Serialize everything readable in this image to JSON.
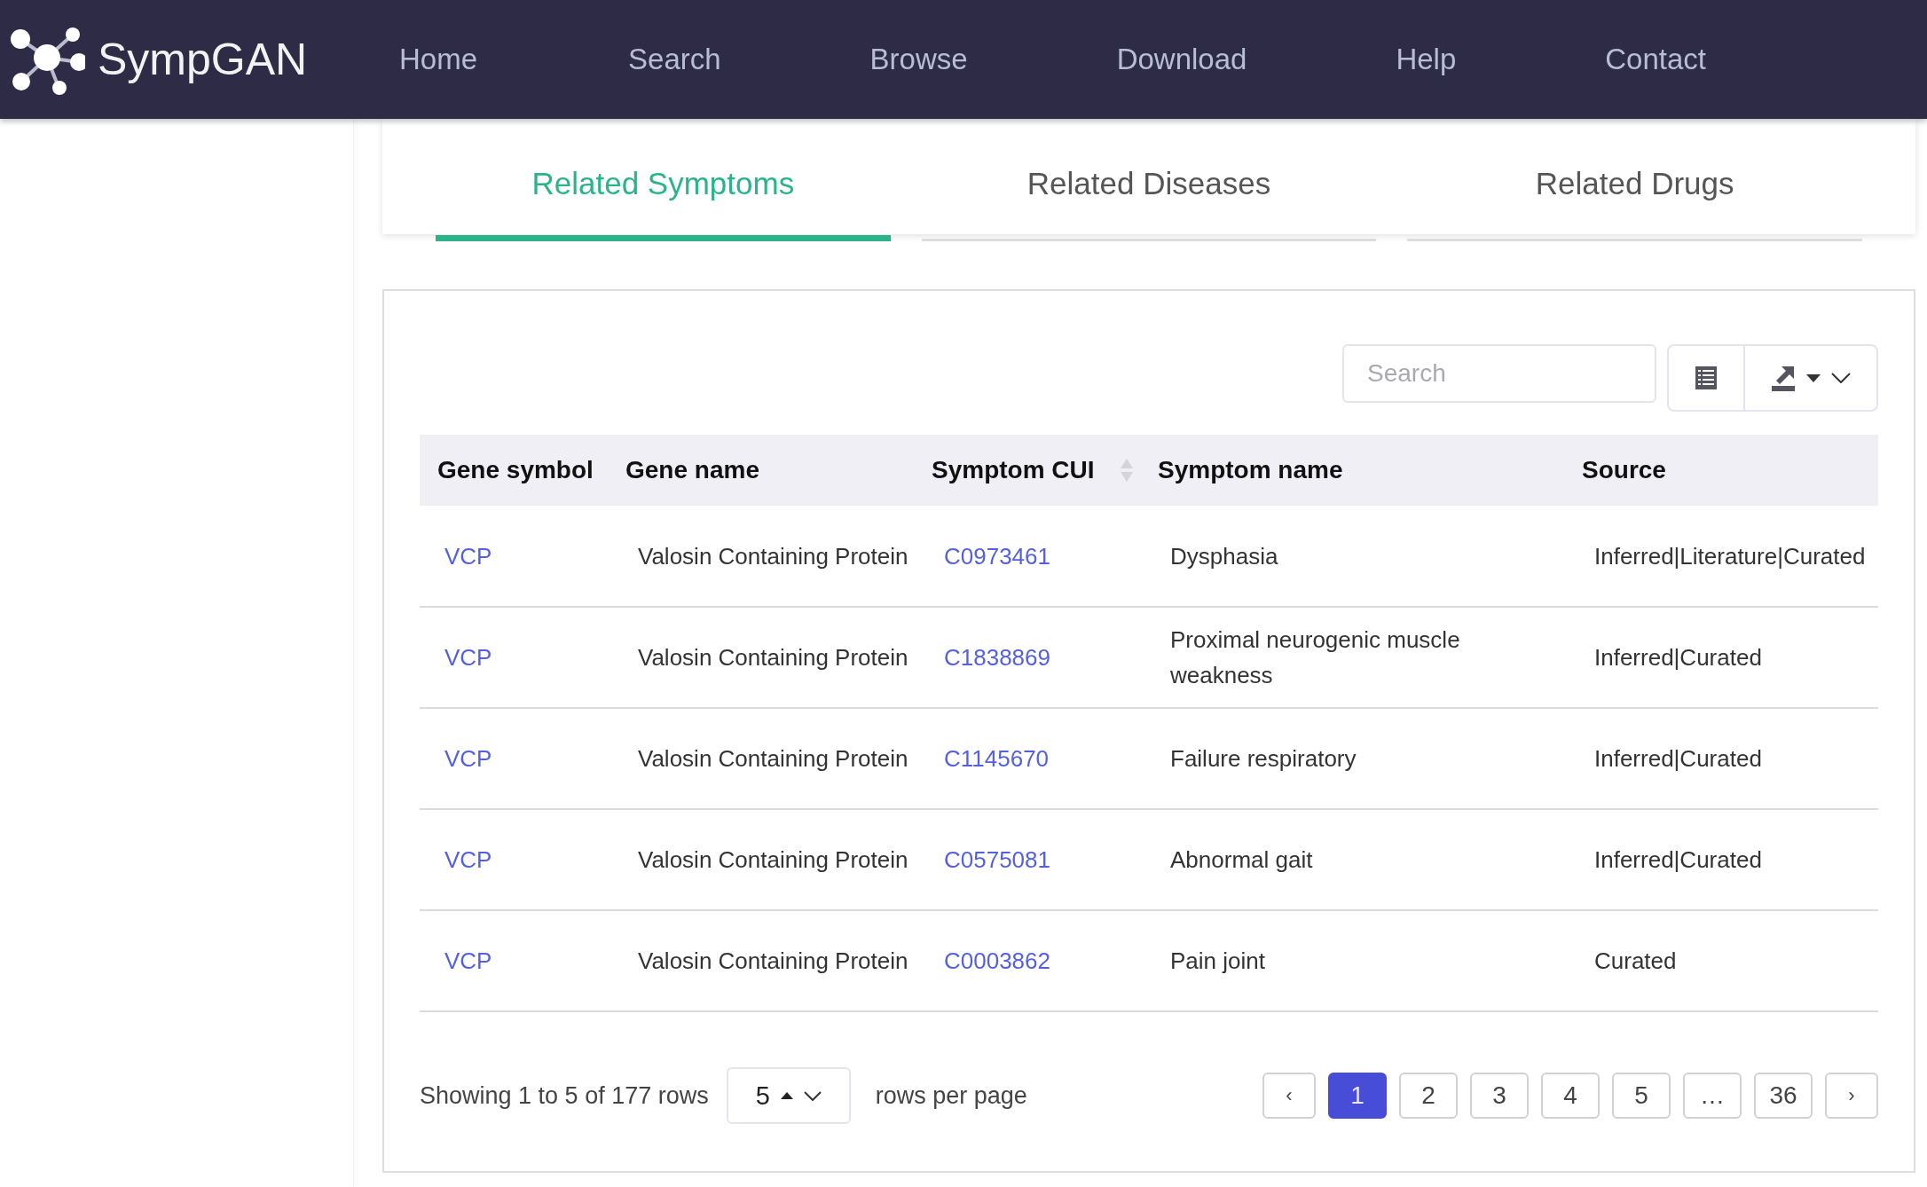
{
  "brand": "SympGAN",
  "nav": [
    {
      "label": "Home"
    },
    {
      "label": "Search"
    },
    {
      "label": "Browse"
    },
    {
      "label": "Download"
    },
    {
      "label": "Help"
    },
    {
      "label": "Contact"
    }
  ],
  "tabs": [
    {
      "label": "Related Symptoms",
      "selected": true
    },
    {
      "label": "Related Diseases",
      "selected": false
    },
    {
      "label": "Related Drugs",
      "selected": false
    }
  ],
  "toolbar": {
    "placeholder": "Search"
  },
  "table": {
    "columns": [
      {
        "label": "Gene symbol",
        "sortable": false
      },
      {
        "label": "Gene name",
        "sortable": false
      },
      {
        "label": "Symptom CUI",
        "sortable": true
      },
      {
        "label": "Symptom name",
        "sortable": false
      },
      {
        "label": "Source",
        "sortable": false
      }
    ],
    "rows": [
      {
        "gene_symbol": "VCP",
        "gene_name": "Valosin Containing Protein",
        "symptom_cui": "C0973461",
        "symptom_name": "Dysphasia",
        "source": "Inferred|Literature|Curated"
      },
      {
        "gene_symbol": "VCP",
        "gene_name": "Valosin Containing Protein",
        "symptom_cui": "C1838869",
        "symptom_name": "Proximal neurogenic muscle weakness",
        "source": "Inferred|Curated"
      },
      {
        "gene_symbol": "VCP",
        "gene_name": "Valosin Containing Protein",
        "symptom_cui": "C1145670",
        "symptom_name": "Failure respiratory",
        "source": "Inferred|Curated"
      },
      {
        "gene_symbol": "VCP",
        "gene_name": "Valosin Containing Protein",
        "symptom_cui": "C0575081",
        "symptom_name": "Abnormal gait",
        "source": "Inferred|Curated"
      },
      {
        "gene_symbol": "VCP",
        "gene_name": "Valosin Containing Protein",
        "symptom_cui": "C0003862",
        "symptom_name": "Pain joint",
        "source": "Curated"
      }
    ]
  },
  "footer": {
    "summary": "Showing 1 to 5 of 177 rows",
    "page_size": "5",
    "suffix": "rows per page"
  },
  "pagination": {
    "prev": "‹",
    "next": "›",
    "pages": [
      {
        "label": "1",
        "selected": true
      },
      {
        "label": "2",
        "selected": false
      },
      {
        "label": "3",
        "selected": false
      },
      {
        "label": "4",
        "selected": false
      },
      {
        "label": "5",
        "selected": false
      },
      {
        "label": "…",
        "selected": false
      },
      {
        "label": "36",
        "selected": false
      }
    ]
  }
}
